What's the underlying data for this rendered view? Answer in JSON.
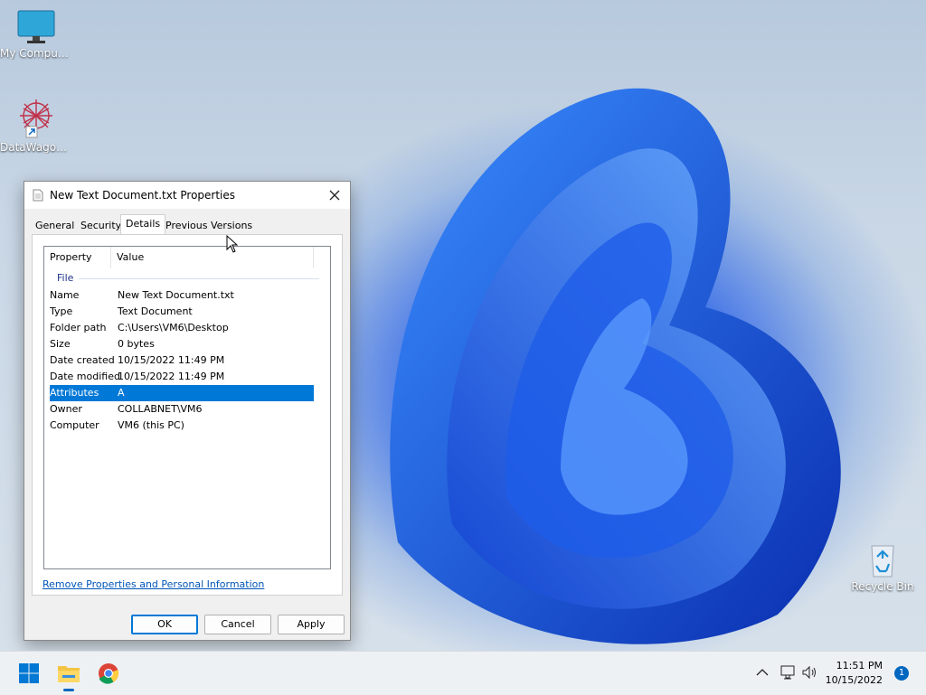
{
  "desktop": {
    "icons": [
      {
        "label": "My Computer"
      },
      {
        "label": "DataWagon..."
      },
      {
        "label": "Recycle Bin"
      }
    ]
  },
  "dialog": {
    "title": "New Text Document.txt Properties",
    "tabs": [
      "General",
      "Security",
      "Details",
      "Previous Versions"
    ],
    "active_tab": "Details",
    "columns": [
      "Property",
      "Value"
    ],
    "group": "File",
    "rows": [
      {
        "property": "Name",
        "value": "New Text Document.txt"
      },
      {
        "property": "Type",
        "value": "Text Document"
      },
      {
        "property": "Folder path",
        "value": "C:\\Users\\VM6\\Desktop"
      },
      {
        "property": "Size",
        "value": "0 bytes"
      },
      {
        "property": "Date created",
        "value": "10/15/2022 11:49 PM"
      },
      {
        "property": "Date modified",
        "value": "10/15/2022 11:49 PM"
      },
      {
        "property": "Attributes",
        "value": "A"
      },
      {
        "property": "Owner",
        "value": "COLLABNET\\VM6"
      },
      {
        "property": "Computer",
        "value": "VM6 (this PC)"
      }
    ],
    "selected_row": "Attributes",
    "remove_link": "Remove Properties and Personal Information",
    "buttons": {
      "ok": "OK",
      "cancel": "Cancel",
      "apply": "Apply"
    }
  },
  "taskbar": {
    "time": "11:51 PM",
    "date": "10/15/2022",
    "notification_count": "1"
  },
  "colors": {
    "selection": "#0078d7",
    "link": "#0056b8",
    "accent": "#0067c0"
  }
}
